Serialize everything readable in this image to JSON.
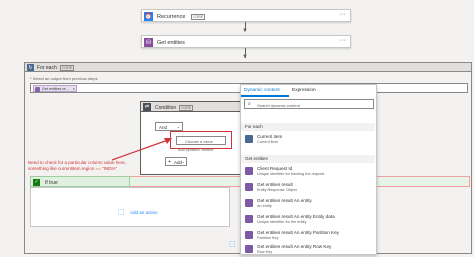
{
  "recurrence": {
    "label": "Recurrence",
    "badge": "CORE"
  },
  "get_entities": {
    "label": "Get entities"
  },
  "foreach": {
    "label": "For each",
    "badge": "CORE",
    "select_label": "* Select an output from previous steps",
    "token": "Get entities re..."
  },
  "condition": {
    "label": "Condition",
    "badge": "CORE",
    "and_label": "And",
    "choose_placeholder": "Choose a value",
    "add_dynamic": "Add dynamic content",
    "add_label": "Add"
  },
  "if_true": {
    "label": "If true"
  },
  "add_action": "Add an action",
  "annotation": "Need to check for a particular column value here, something like currentitem.region == \"INDIA\"",
  "panel": {
    "tabs": [
      "Dynamic content",
      "Expression"
    ],
    "search_placeholder": "Search dynamic content",
    "sections": [
      {
        "title": "For each",
        "items": [
          {
            "title": "Current item",
            "sub": "Current item"
          }
        ]
      },
      {
        "title": "Get entities",
        "items": [
          {
            "title": "Client Request Id",
            "sub": "Unique identifier for tracking the request"
          },
          {
            "title": "Get entities result",
            "sub": "Entity Response Object"
          },
          {
            "title": "Get entities result An entity",
            "sub": "An entity"
          },
          {
            "title": "Get entities result An entity Entity data",
            "sub": "Unique identifier for the entity"
          },
          {
            "title": "Get entities result An entity Partition Key",
            "sub": "Partition Key"
          },
          {
            "title": "Get entities result An entity Row Key",
            "sub": "Row Key"
          }
        ]
      }
    ]
  },
  "colors": {
    "blue": "#1f85ff",
    "purple": "#8a4e9e",
    "red": "#d13438",
    "green": "#107c10"
  }
}
